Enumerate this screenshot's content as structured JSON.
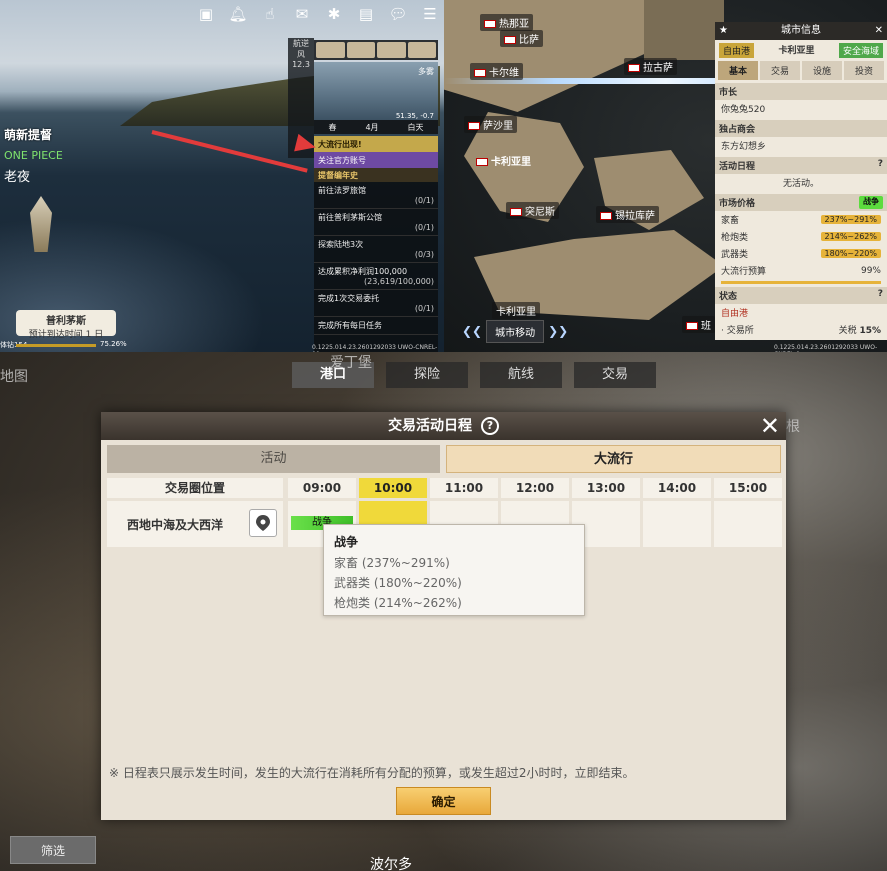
{
  "top_left": {
    "player_name": "萌新提督",
    "guild": "ONE PIECE",
    "nickname": "老夜",
    "port_banner": {
      "name": "普利茅斯",
      "eta": "预计到达时间 1 日"
    },
    "bottom_left": "体钻154",
    "progress_text": "75.26%",
    "season": "春",
    "month": "4月",
    "time_of_day": "白天",
    "weather": "多雾",
    "coords": "51.35, -0.7",
    "side_labels": [
      "航逆",
      "风",
      "12.3"
    ],
    "quests": {
      "alert": "大流行出现!",
      "follow": "关注官方账号",
      "section": "提督编年史",
      "items": [
        {
          "text": "前往法罗旅馆",
          "progress": "(0/1)"
        },
        {
          "text": "前往普利茅斯公馆",
          "progress": "(0/1)"
        },
        {
          "text": "探索陆地3次",
          "progress": "(0/3)"
        },
        {
          "text": "达成累积净利润100,000",
          "progress": "(23,619/100,000)"
        },
        {
          "text": "完成1次交易委托",
          "progress": "(0/1)"
        },
        {
          "text": "完成所有每日任务",
          "progress": ""
        }
      ]
    },
    "version": "0.1225.014.23.2601292033 UWO-CNREL-00"
  },
  "top_right": {
    "cities": [
      "热那亚",
      "比萨",
      "卡尔维",
      "拉古萨",
      "萨沙里",
      "卡利亚里",
      "突尼斯",
      "锡拉库萨",
      "卡利亚里",
      "班"
    ],
    "city_move_button": "城市移动",
    "version": "0.1225.014.23.2601292033 UWO-CNREL-0",
    "panel_title": "城市信息",
    "badge_free_port": "自由港",
    "city_name": "卡利亚里",
    "badge_safe": "安全海域",
    "tabs": [
      "基本",
      "交易",
      "设施",
      "投资"
    ],
    "mayor_label": "市长",
    "mayor": "你兔兔520",
    "monopoly_label": "独占商会",
    "monopoly": "东方幻想乡",
    "schedule_label": "活动日程",
    "schedule_value": "无活动。",
    "market_label": "市场价格",
    "war_label": "战争",
    "market": [
      {
        "name": "家畜",
        "range": "237%~291%"
      },
      {
        "name": "枪炮类",
        "range": "214%~262%"
      },
      {
        "name": "武器类",
        "range": "180%~220%"
      }
    ],
    "budget_label": "大流行预算",
    "budget_value": "99%",
    "status_label": "状态",
    "status_value": "自由港",
    "trade_label": "· 交易所",
    "tax_label": "关税",
    "tax_value": "15%"
  },
  "bottom": {
    "bg_tabs": [
      "港口",
      "探险",
      "航线",
      "交易"
    ],
    "bg_labels": {
      "map": "地图",
      "city1": "爱丁堡",
      "city2": "根",
      "city3": "波尔多"
    },
    "filter_button": "筛选",
    "dialog": {
      "title": "交易活动日程",
      "help": "?",
      "tab_activity": "活动",
      "tab_pandemic": "大流行",
      "col_location": "交易圈位置",
      "times": [
        "09:00",
        "10:00",
        "11:00",
        "12:00",
        "13:00",
        "14:00",
        "15:00"
      ],
      "current_time_index": 1,
      "region": "西地中海及大西洋",
      "war_bar_label": "战争",
      "tooltip": {
        "title": "战争",
        "lines": [
          "家畜 (237%~291%)",
          "武器类 (180%~220%)",
          "枪炮类 (214%~262%)"
        ]
      },
      "note": "※ 日程表只展示发生时间，发生的大流行在消耗所有分配的预算，或发生超过2小时时，立即结束。",
      "confirm": "确定"
    }
  }
}
